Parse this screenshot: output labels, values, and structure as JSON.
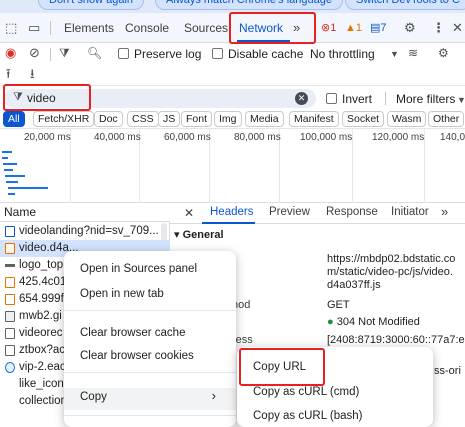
{
  "banner": {
    "pills": [
      "Don't show again",
      "Always match Chrome's language",
      "Switch DevTools to C"
    ]
  },
  "devtools_tabs": {
    "items": [
      "Elements",
      "Console",
      "Sources",
      "Network"
    ],
    "active": "Network",
    "more": "»",
    "errors": "1",
    "warnings": "1",
    "messages": "7"
  },
  "toolbar": {
    "preserve_log": "Preserve log",
    "disable_cache": "Disable cache",
    "throttling": "No throttling"
  },
  "filter": {
    "value": "video",
    "invert": "Invert",
    "more_filters": "More filters"
  },
  "type_chips": [
    "All",
    "Fetch/XHR",
    "Doc",
    "CSS",
    "JS",
    "Font",
    "Img",
    "Media",
    "Manifest",
    "Socket",
    "Wasm",
    "Other"
  ],
  "timeline": {
    "ticks": [
      "20,000 ms",
      "40,000 ms",
      "60,000 ms",
      "80,000 ms",
      "100,000 ms",
      "120,000 ms",
      "140,00"
    ]
  },
  "requests": {
    "header": "Name",
    "rows": [
      "videolanding?nid=sv_709...",
      "video.d4a...",
      "logo_top",
      "425.4c01",
      "654.999f",
      "mwb2.gi",
      "videorec",
      "ztbox?ac",
      "vip-2.eac",
      "like_icon",
      "collection"
    ]
  },
  "details": {
    "tabs": [
      "Headers",
      "Preview",
      "Response",
      "Initiator"
    ],
    "active_tab": "Headers",
    "section": "General",
    "url_lines": [
      "https://mbdp02.bdstatic.co",
      "m/static/video-pc/js/video.",
      "d4a037ff.js"
    ],
    "method_key": "hod",
    "method": "GET",
    "status": "304 Not Modified",
    "address_key": "ress",
    "address": "[2408:8719:3000:60::77a7:e",
    "policy_fragment": "ss-ori"
  },
  "context_menu": {
    "items": [
      "Open in Sources panel",
      "Open in new tab",
      "Clear browser cache",
      "Clear browser cookies",
      "Copy"
    ],
    "copy_arrow": "›"
  },
  "copy_submenu": {
    "items": [
      "Copy URL",
      "Copy as cURL (cmd)",
      "Copy as cURL (bash)"
    ]
  },
  "colors": {
    "accent": "#0b57d0",
    "highlight": "#e8201f",
    "status_ok": "#1e8e3e",
    "error": "#d93025",
    "warning": "#e37400"
  }
}
